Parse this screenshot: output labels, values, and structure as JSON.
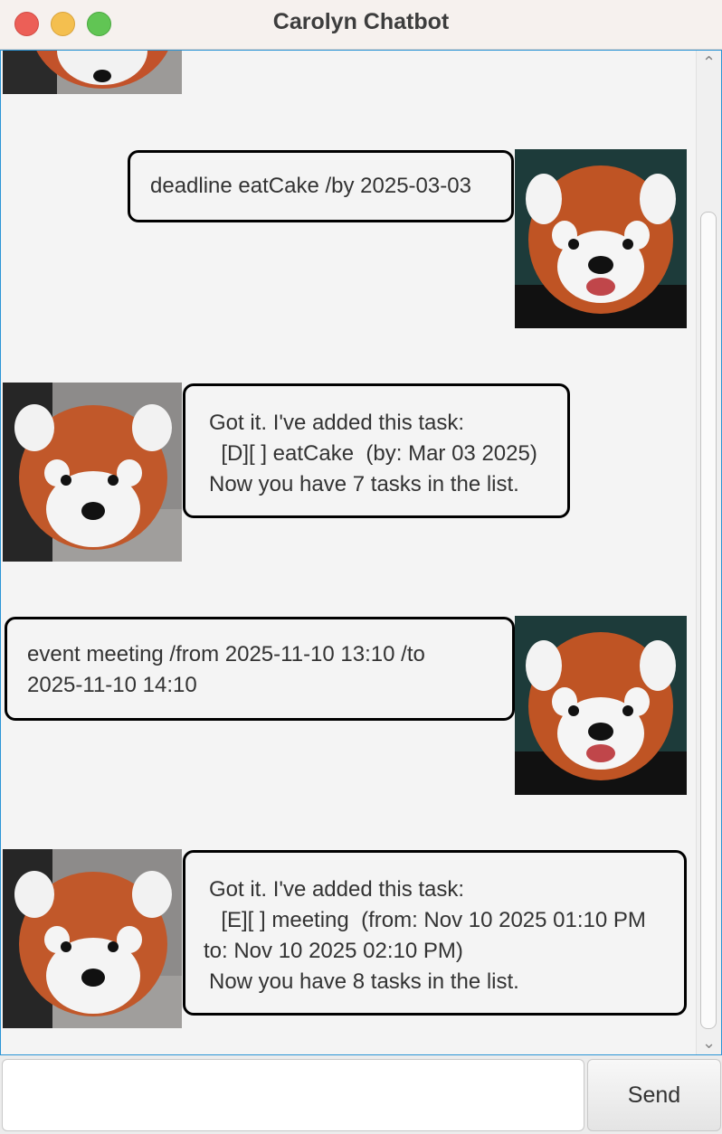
{
  "window": {
    "title": "Carolyn Chatbot"
  },
  "messages": [
    {
      "sender": "bot",
      "avatar_icon": "red-panda-avatar-icon",
      "lines": []
    },
    {
      "sender": "user",
      "avatar_icon": "red-panda-avatar-icon",
      "lines": [
        "deadline eatCake /by 2025-03-03"
      ]
    },
    {
      "sender": "bot",
      "avatar_icon": "red-panda-avatar-icon",
      "lines": [
        "Got it. I've added this task:",
        "  [D][ ] eatCake  (by: Mar 03 2025)",
        "Now you have 7 tasks in the list."
      ]
    },
    {
      "sender": "user",
      "avatar_icon": "red-panda-avatar-icon",
      "lines": [
        "event meeting /from 2025-11-10 13:10 /to",
        "2025-11-10 14:10"
      ]
    },
    {
      "sender": "bot",
      "avatar_icon": "red-panda-avatar-icon",
      "lines": [
        "Got it. I've added this task:",
        "  [E][ ] meeting  (from: Nov 10 2025 01:10 PM",
        "to: Nov 10 2025 02:10 PM)",
        "Now you have 8 tasks in the list."
      ]
    }
  ],
  "input": {
    "value": "",
    "placeholder": ""
  },
  "send_button": {
    "label": "Send"
  },
  "colors": {
    "focus_border": "#2b95d6",
    "bubble_border": "#000000",
    "background": "#f4f4f4"
  }
}
